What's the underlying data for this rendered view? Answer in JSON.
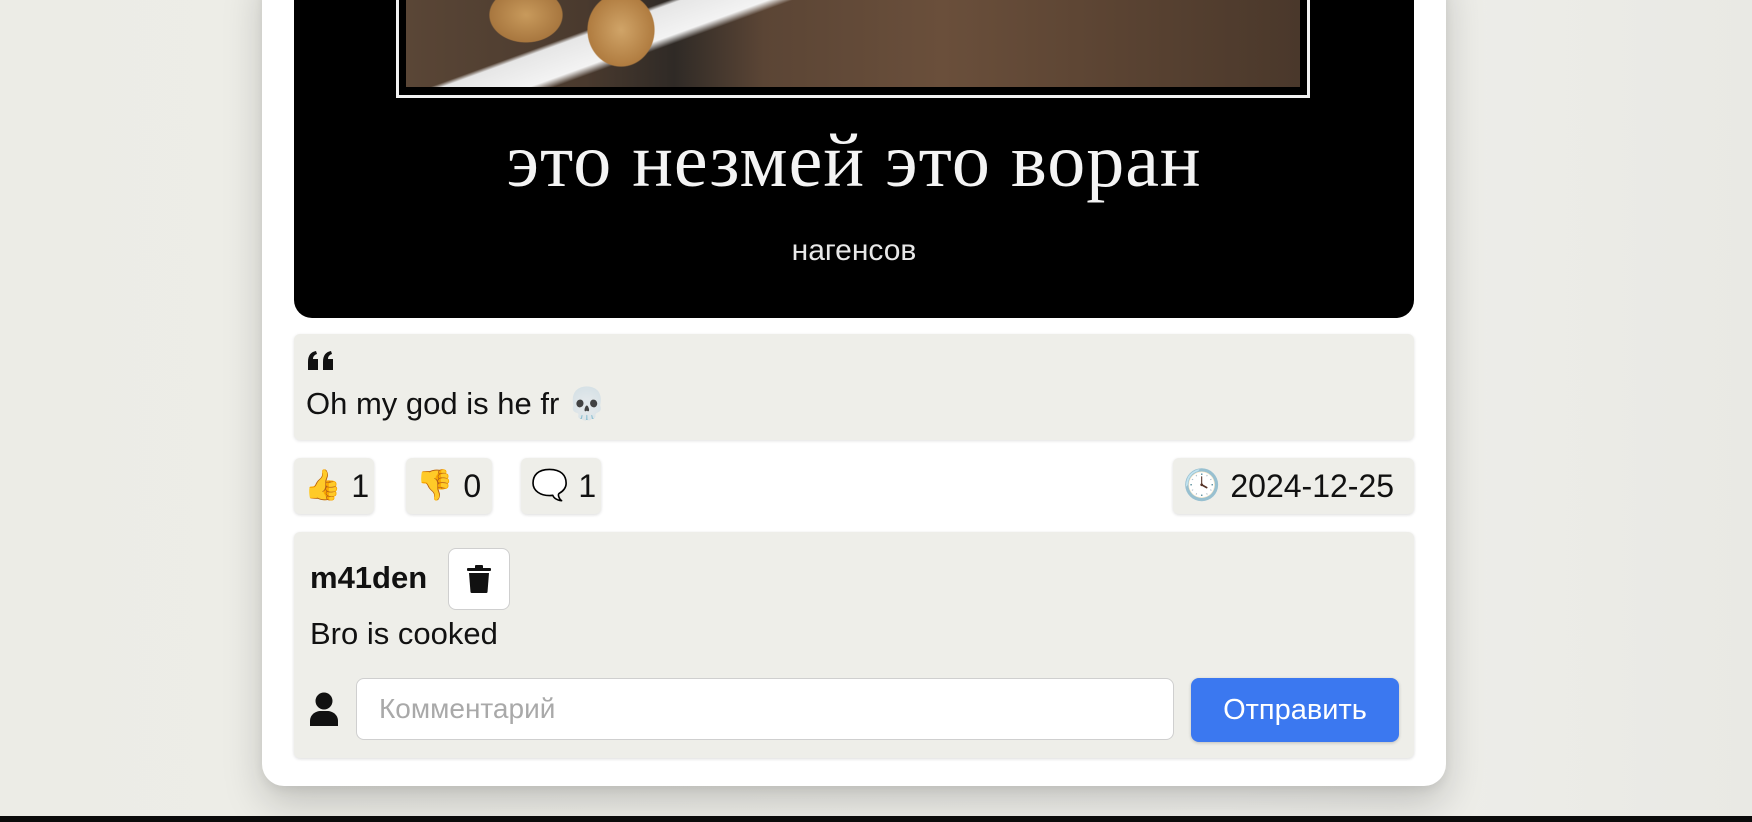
{
  "post": {
    "meme": {
      "caption": "это незмей это воран",
      "subcaption": "нагенсов"
    },
    "quote": {
      "text": "Oh my god is he fr 💀"
    },
    "stats": {
      "like_emoji": "👍",
      "likes": "1",
      "dislike_emoji": "👎",
      "dislikes": "0",
      "comment_emoji": "🗨️",
      "comments": "1",
      "clock_emoji": "🕓",
      "date": "2024-12-25"
    }
  },
  "comments": {
    "items": [
      {
        "author": "m41den",
        "text": "Bro is cooked"
      }
    ],
    "input_placeholder": "Комментарий",
    "send_label": "Отправить"
  },
  "colors": {
    "accent": "#3b78f0",
    "panel": "#eeeee9",
    "background": "#ecece7"
  }
}
